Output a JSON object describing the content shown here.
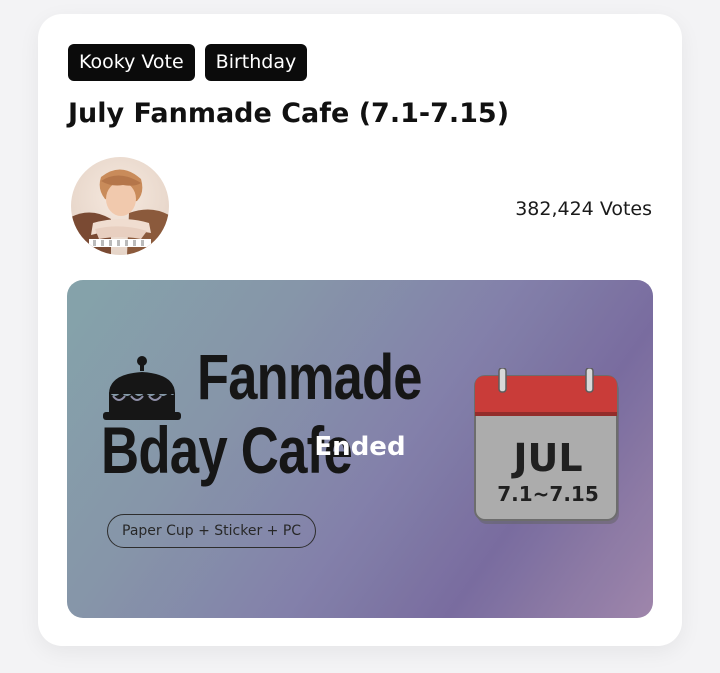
{
  "tags": [
    "Kooky Vote",
    "Birthday"
  ],
  "title": "July Fanmade Cafe (7.1-7.15)",
  "votes_text": "382,424 Votes",
  "banner": {
    "line1": "Fanmade",
    "line2": "Bday Cafe",
    "pill": "Paper Cup + Sticker + PC",
    "calendar_month": "JUL",
    "calendar_dates": "7.1~7.15",
    "status": "Ended"
  },
  "colors": {
    "tag_bg": "#0b0b0b",
    "calendar_top": "#c7322f",
    "calendar_body": "#a8a8a8"
  },
  "icons": {
    "cake": "cake-icon",
    "calendar": "calendar-icon",
    "avatar": "avatar"
  }
}
